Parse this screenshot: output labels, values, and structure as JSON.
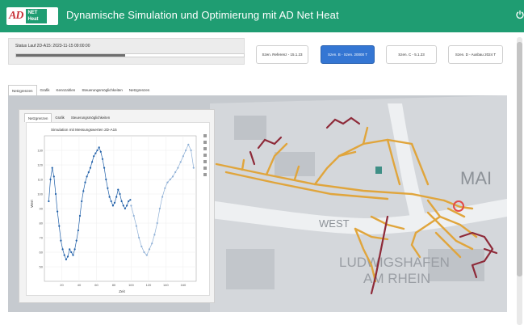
{
  "header": {
    "logo_text": "AD",
    "logo_sub": "NET Heat",
    "title": "Dynamische Simulation und Optimierung mit AD Net Heat",
    "right_icon": "power-icon"
  },
  "status": {
    "text": "Status Lauf 2D-A15: 2023-11-15 09:00:00",
    "progress": 0.48
  },
  "scenarios": [
    {
      "label": "Szen. Referenz - 15.1.23",
      "active": false
    },
    {
      "label": "Szen. B - Szen. 20000 T",
      "active": true
    },
    {
      "label": "Szen. C - 5.1.23",
      "active": false
    },
    {
      "label": "Szen. D - Ausbau 2024 T",
      "active": false
    }
  ],
  "tabs": [
    "Netzgrenzen",
    "Grafik",
    "Kennzahlen",
    "Steuerungsmöglichkeiten",
    "Netzgrenzen"
  ],
  "plot_tabs": [
    "Netzgrenzen",
    "Grafik",
    "Steuerungsmöglichkeiten"
  ],
  "map_labels": {
    "ma": "MAI",
    "west": "WEST",
    "ludwig1": "LUDWIGSHAFEN",
    "ludwig2": "AM RHEIN"
  },
  "colors": {
    "header": "#1f9d72",
    "active_button": "#3476d3",
    "pipe_orange": "#e0a53c",
    "pipe_red": "#8e2a39",
    "marker_red": "#e34a4a"
  },
  "chart_data": {
    "type": "scatter",
    "title": "Simulation mit Messungswerten 2D-A15",
    "xlabel": "Zeit",
    "ylabel": "Wert",
    "xlim": [
      0,
      175
    ],
    "ylim": [
      40,
      140
    ],
    "x_ticks": [
      "20",
      "40",
      "60",
      "80",
      "100",
      "120",
      "140",
      "160"
    ],
    "y_ticks": [
      "50",
      "60",
      "70",
      "80",
      "90",
      "100",
      "110",
      "120",
      "130"
    ],
    "series": [
      {
        "color": "#1f5fa8",
        "x": [
          5,
          7,
          9,
          11,
          13,
          15,
          17,
          19,
          21,
          23,
          25,
          27,
          29,
          31,
          33,
          35,
          37,
          39,
          41,
          43,
          45,
          47,
          49,
          51,
          53,
          55,
          57,
          59,
          61,
          63,
          65,
          67,
          69,
          71,
          73,
          75,
          77,
          79,
          81,
          83,
          85,
          87,
          89,
          91,
          93,
          95,
          97,
          99
        ],
        "y": [
          95,
          110,
          118,
          112,
          100,
          88,
          78,
          68,
          62,
          58,
          55,
          57,
          62,
          60,
          58,
          62,
          68,
          75,
          85,
          95,
          102,
          108,
          112,
          115,
          118,
          122,
          126,
          128,
          130,
          132,
          129,
          124,
          118,
          110,
          104,
          98,
          95,
          92,
          94,
          98,
          103,
          100,
          95,
          92,
          90,
          92,
          95,
          96
        ]
      },
      {
        "color": "#8fb0d6",
        "x": [
          100,
          103,
          106,
          109,
          112,
          115,
          118,
          121,
          124,
          127,
          130,
          133,
          136,
          139,
          142,
          145,
          148,
          151,
          154,
          157,
          160,
          163,
          166,
          169,
          172
        ],
        "y": [
          92,
          85,
          78,
          70,
          64,
          60,
          58,
          62,
          66,
          72,
          80,
          90,
          98,
          104,
          108,
          110,
          112,
          115,
          118,
          122,
          126,
          130,
          134,
          130,
          118
        ]
      }
    ]
  }
}
